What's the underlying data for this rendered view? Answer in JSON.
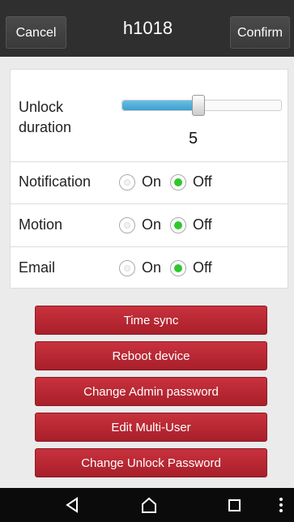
{
  "header": {
    "cancel_label": "Cancel",
    "title": "h1018",
    "confirm_label": "Confirm"
  },
  "settings": {
    "unlock_duration": {
      "label": "Unlock duration",
      "value": "5",
      "slider_fraction": 0.47
    },
    "rows": [
      {
        "label": "Notification",
        "on_label": "On",
        "off_label": "Off",
        "selected": "Off"
      },
      {
        "label": "Motion",
        "on_label": "On",
        "off_label": "Off",
        "selected": "Off"
      },
      {
        "label": "Email",
        "on_label": "On",
        "off_label": "Off",
        "selected": "Off"
      }
    ]
  },
  "actions": [
    "Time sync",
    "Reboot device",
    "Change Admin password",
    "Edit Multi-User",
    "Change Unlock Password"
  ],
  "navbar": {
    "icons": [
      "back-icon",
      "home-icon",
      "recents-icon",
      "overflow-menu-icon"
    ]
  },
  "colors": {
    "topbar": "#2f2f2f",
    "action_button": "#b52531",
    "slider_fill": "#4aa8d8",
    "radio_selected": "#2ec82e",
    "navbar": "#0b0b0b"
  }
}
